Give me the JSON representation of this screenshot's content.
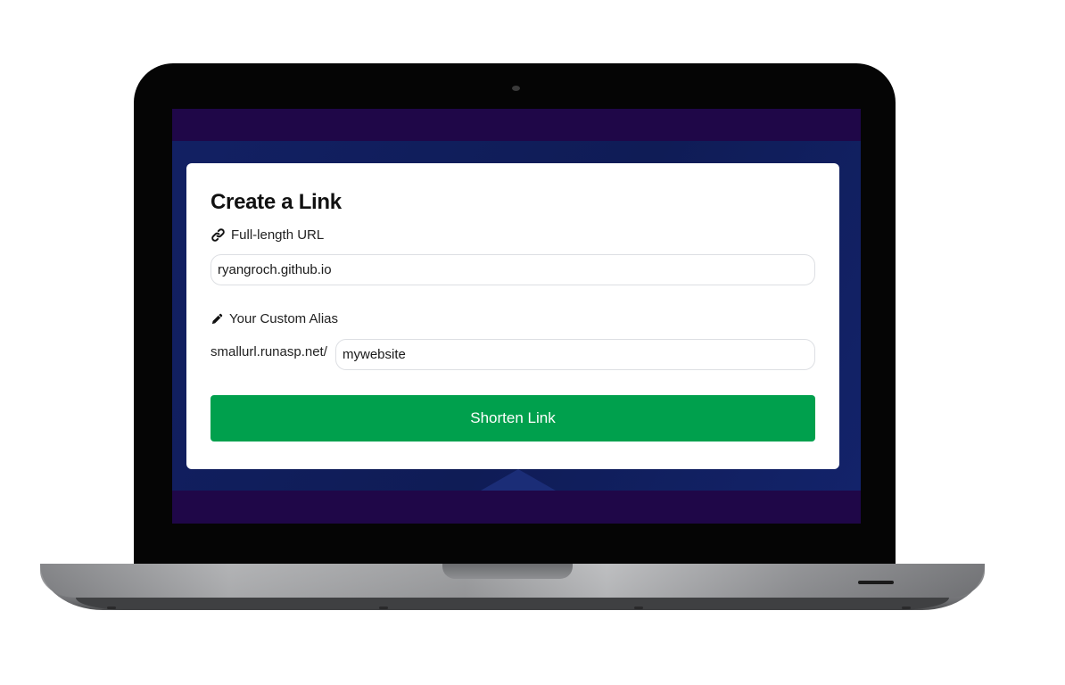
{
  "card": {
    "title": "Create a Link",
    "url_label": "Full-length URL",
    "url_value": "ryangroch.github.io",
    "alias_label": "Your Custom Alias",
    "alias_prefix": "smallurl.runasp.net/",
    "alias_value": "mywebsite",
    "submit_label": "Shorten Link"
  },
  "icons": {
    "url_label_icon": "link-icon",
    "alias_label_icon": "pencil-icon"
  },
  "colors": {
    "screen_background": "#0f1b52",
    "screen_bands": "#1f0748",
    "submit_button": "#00a04d",
    "card_background": "#ffffff"
  }
}
